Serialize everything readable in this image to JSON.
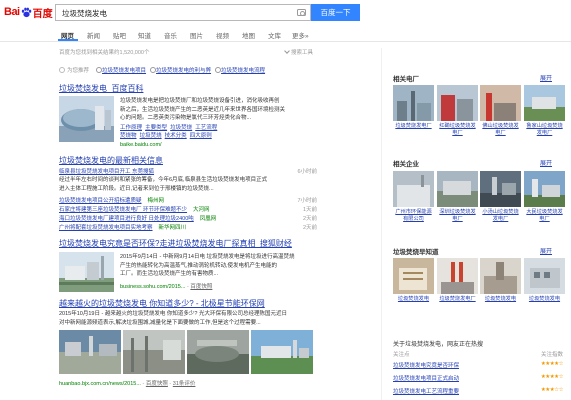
{
  "logo": {
    "bai": "Bai",
    "du": "百度"
  },
  "search": {
    "query": "垃圾焚烧发电",
    "button": "百度一下"
  },
  "tabs": [
    "网页",
    "新闻",
    "贴吧",
    "知道",
    "音乐",
    "图片",
    "视频",
    "地图",
    "文库",
    "更多»"
  ],
  "meta": {
    "result_count": "百度为您找到相关结果约1,520,000个",
    "tools": "搜索工具"
  },
  "recommend": {
    "label": "为您推荐",
    "links": [
      "垃圾焚烧发电项目",
      "垃圾焚烧发电的利与弊",
      "垃圾焚烧发电流程"
    ]
  },
  "result1": {
    "title": "垃圾焚烧发电_百度百科",
    "desc_lines": [
      "垃圾焚烧发电是把垃圾焚烧厂和垃圾焚烧设备引进，消化吸收再创",
      "新之后，生活垃圾焚烧产生的二恶英是近几年来世界各国环境检测关",
      "心的问题。二恶英类污染物是氯代三环芳烃类化合物..."
    ],
    "sublinks": [
      "工作原理",
      "主要类型",
      "垃圾焚烧",
      "工艺流程"
    ],
    "sublinks2": [
      "焚烧物",
      "垃圾焚烧",
      "技术分类",
      "四大原则"
    ],
    "url": "baike.baidu.com/"
  },
  "result2": {
    "title": "垃圾焚烧发电的最新相关信息",
    "headline": "临泉县垃圾焚烧发电项目开工 东莞搜狐",
    "desc_lines": [
      "经过半年左右时间的谈判和紧张的筹备，今年6月底,临泉县生活垃圾焚烧发电项目正式",
      "进入主体工程施工阶段。近日,记者来到位于邢楼镇的垃圾焚烧..."
    ],
    "news": [
      {
        "title": "垃圾焚烧发电项目公开招标遭质疑",
        "source": "梅州网",
        "date": "7小时前"
      },
      {
        "title": "石家庄将建第三座垃圾焚烧发电厂 环节环保难题不少",
        "source": "大河网",
        "date": "1天前"
      },
      {
        "title": "海口垃圾焚烧发电厂建项目进行良好 日处理垃圾2400吨",
        "source": "凤凰网",
        "date": "2天前"
      },
      {
        "title": "广州将配套垃圾焚烧发电项目实地考察",
        "source": "新华网四川",
        "date": "2天前"
      }
    ],
    "source_first": "东莞搜狐",
    "date_first": "6小时前"
  },
  "result3": {
    "title": "垃圾焚烧发电究竟是否环保?走进垃圾焚烧发电厂探真相_搜狐财经",
    "desc_lines": [
      "2015年9月14日 - 中新网9月14日电 垃圾焚烧发电是将垃圾进行高温焚烧",
      "产生的热能转化为高温蒸气,推动涡轮机转动,使发电机产生电能的",
      "工厂。而生活垃圾焚烧产生的有害物质..."
    ],
    "url": "business.sohu.com/2015...",
    "snapshot": "百度快照"
  },
  "result4": {
    "title": "越来越火的垃圾焚烧发电 你知道多少? - 北极星节能环保网",
    "desc_lines": [
      "2015年10月19日 - 越来越火的垃圾焚烧发电 你知道多少? 光大环保有限公司总经理陈国元近日",
      "对中新网能源频道表示,解决垃圾围城,减量化是下面要做的工作,但是这个过程需要..."
    ],
    "url": "huanbao.bjx.com.cn/news/2015...",
    "snapshot": "百度快照",
    "comments": "31条评价"
  },
  "sidebar": {
    "related_plants": {
      "title": "相关电厂",
      "expand": "展开",
      "items": [
        "垃圾焚烧发电厂",
        "红磡垃圾焚烧发电厂",
        "佛山垃圾焚烧发电厂",
        "鲁家山垃圾焚烧发电厂"
      ]
    },
    "related_companies": {
      "title": "相关企业",
      "expand": "展开",
      "items": [
        "广州市环保能源有限公司",
        "深圳垃圾焚烧发电厂",
        "小汤山垃圾焚烧发电厂",
        "大民垃圾焚烧发电厂"
      ]
    },
    "early_know": {
      "title": "垃圾焚烧早知道",
      "expand": "展开",
      "items": [
        "垃圾焚烧发电",
        "垃圾焚烧发电厂",
        "垃圾焚烧发电",
        "垃圾焚烧发电"
      ]
    },
    "hot": {
      "title": "关于垃圾焚烧发电，网友正在热搜",
      "col_left": "关注点",
      "col_right": "关注指数",
      "rows": [
        {
          "text": "垃圾焚烧发电究竟是否环保",
          "stars": "★★★★☆"
        },
        {
          "text": "垃圾焚烧发电项目正式启动",
          "stars": "★★★★☆"
        },
        {
          "text": "垃圾焚烧发电工艺流程重要",
          "stars": "★★★☆☆"
        }
      ]
    }
  }
}
